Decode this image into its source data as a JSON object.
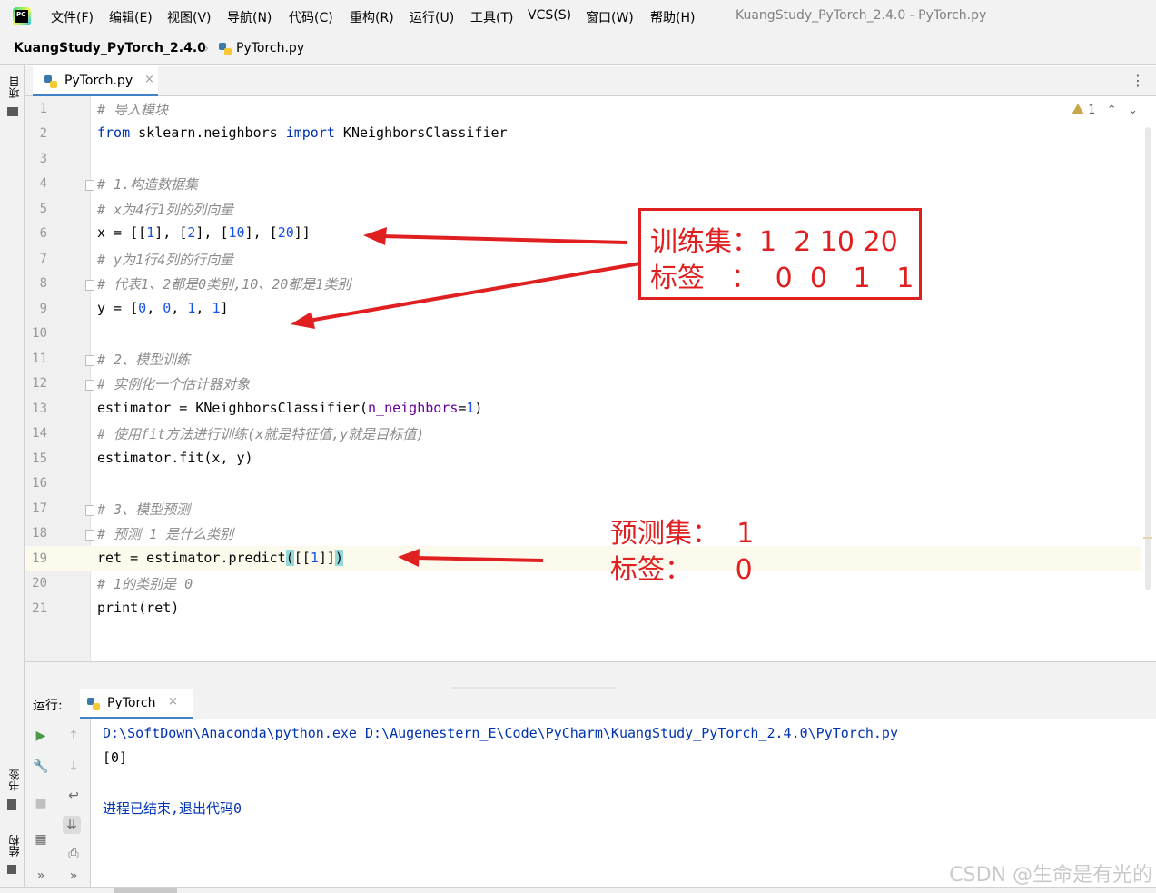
{
  "menubar": {
    "app_icon_text": "PC",
    "items": [
      "文件(F)",
      "编辑(E)",
      "视图(V)",
      "导航(N)",
      "代码(C)",
      "重构(R)",
      "运行(U)",
      "工具(T)",
      "VCS(S)",
      "窗口(W)",
      "帮助(H)"
    ],
    "window_title": "KuangStudy_PyTorch_2.4.0 - PyTorch.py"
  },
  "breadcrumb": {
    "project": "KuangStudy_PyTorch_2.4.0",
    "file": "PyTorch.py"
  },
  "left_strip": {
    "project": "项目",
    "bookmarks": "书签",
    "structure": "结构"
  },
  "editor_tab": {
    "label": "PyTorch.py",
    "close": "×",
    "menu": "⋮"
  },
  "inspection": {
    "warning_count": "1",
    "up": "⌃",
    "down": "⌄"
  },
  "code": {
    "lines": [
      {
        "no": "1",
        "text": "# 导入模块"
      },
      {
        "no": "2",
        "text": "from sklearn.neighbors import KNeighborsClassifier"
      },
      {
        "no": "3",
        "text": ""
      },
      {
        "no": "4",
        "text": "# 1.构造数据集"
      },
      {
        "no": "5",
        "text": "# x为4行1列的列向量"
      },
      {
        "no": "6",
        "text": "x = [[1], [2], [10], [20]]"
      },
      {
        "no": "7",
        "text": "# y为1行4列的行向量"
      },
      {
        "no": "8",
        "text": "# 代表1、2都是0类别,10、20都是1类别"
      },
      {
        "no": "9",
        "text": "y = [0, 0, 1, 1]"
      },
      {
        "no": "10",
        "text": ""
      },
      {
        "no": "11",
        "text": "# 2、模型训练"
      },
      {
        "no": "12",
        "text": "# 实例化一个估计器对象"
      },
      {
        "no": "13",
        "text": "estimator = KNeighborsClassifier(n_neighbors=1)"
      },
      {
        "no": "14",
        "text": "# 使用fit方法进行训练(x就是特征值,y就是目标值)"
      },
      {
        "no": "15",
        "text": "estimator.fit(x, y)"
      },
      {
        "no": "16",
        "text": ""
      },
      {
        "no": "17",
        "text": "# 3、模型预测"
      },
      {
        "no": "18",
        "text": "# 预测 1 是什么类别"
      },
      {
        "no": "19",
        "text": "ret = estimator.predict([[1]])"
      },
      {
        "no": "20",
        "text": "# 1的类别是 0"
      },
      {
        "no": "21",
        "text": "print(ret)"
      }
    ]
  },
  "annotations": {
    "train_line1": "训练集：1  2 10 20",
    "train_line2": "标签   ：  0  0   1   1",
    "predict_line1": "预测集：  1",
    "predict_line2": "标签：     0",
    "color": "#e02020"
  },
  "run_panel": {
    "label": "运行:",
    "tab_label": "PyTorch",
    "tab_close": "×",
    "console_lines": [
      "D:\\SoftDown\\Anaconda\\python.exe D:\\Augenestern_E\\Code\\PyCharm\\KuangStudy_PyTorch_2.4.0\\PyTorch.py",
      "[0]",
      "",
      "进程已结束,退出代码0"
    ]
  },
  "watermark": "CSDN @生命是有光的",
  "colors": {
    "keyword": "#0033b3",
    "number": "#1750eb",
    "comment": "#8c8c8c",
    "tab_underline": "#4083c9",
    "run_green": "#4a9a4a"
  }
}
